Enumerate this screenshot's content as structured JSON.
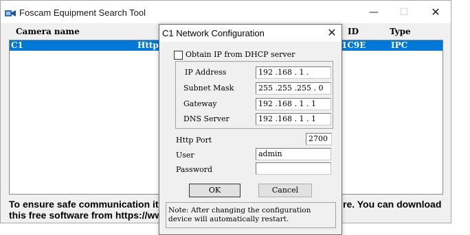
{
  "main_window": {
    "title": "Foscam Equipment Search Tool",
    "controls": {
      "minimize": "—",
      "maximize": "☐",
      "close": "✕"
    },
    "columns": {
      "camera_name": "Camera name",
      "id": "ID",
      "type": "Type"
    },
    "rows": [
      {
        "name": "C1",
        "protocol": "Http",
        "id": "1C9E",
        "type": "IPC",
        "selected": true
      }
    ],
    "notice": {
      "line1_left": "To ensure safe communication it i",
      "line1_right": "re. You can download",
      "line2": "this free software from https://www"
    }
  },
  "dialog": {
    "title": "C1 Network Configuration",
    "close": "✕",
    "dhcp_checkbox": {
      "label": "Obtain IP from DHCP server",
      "checked": false
    },
    "ip_address": {
      "label": "IP Address",
      "value": "192 .168 . 1  ."
    },
    "subnet_mask": {
      "label": "Subnet Mask",
      "value": "255 .255 .255 . 0"
    },
    "gateway": {
      "label": "Gateway",
      "value": "192 .168 . 1  . 1"
    },
    "dns_server": {
      "label": "DNS Server",
      "value": "192 .168 . 1  . 1"
    },
    "http_port": {
      "label": "Http Port",
      "value": "2700"
    },
    "user": {
      "label": "User",
      "value": "admin"
    },
    "password": {
      "label": "Password",
      "value": ""
    },
    "ok_label": "OK",
    "cancel_label": "Cancel",
    "note": {
      "line1": "Note: After changing the configuration",
      "line2": "device will automatically restart."
    }
  },
  "colors": {
    "selection": "#0078d7",
    "window_bg": "#f0f0f0"
  }
}
